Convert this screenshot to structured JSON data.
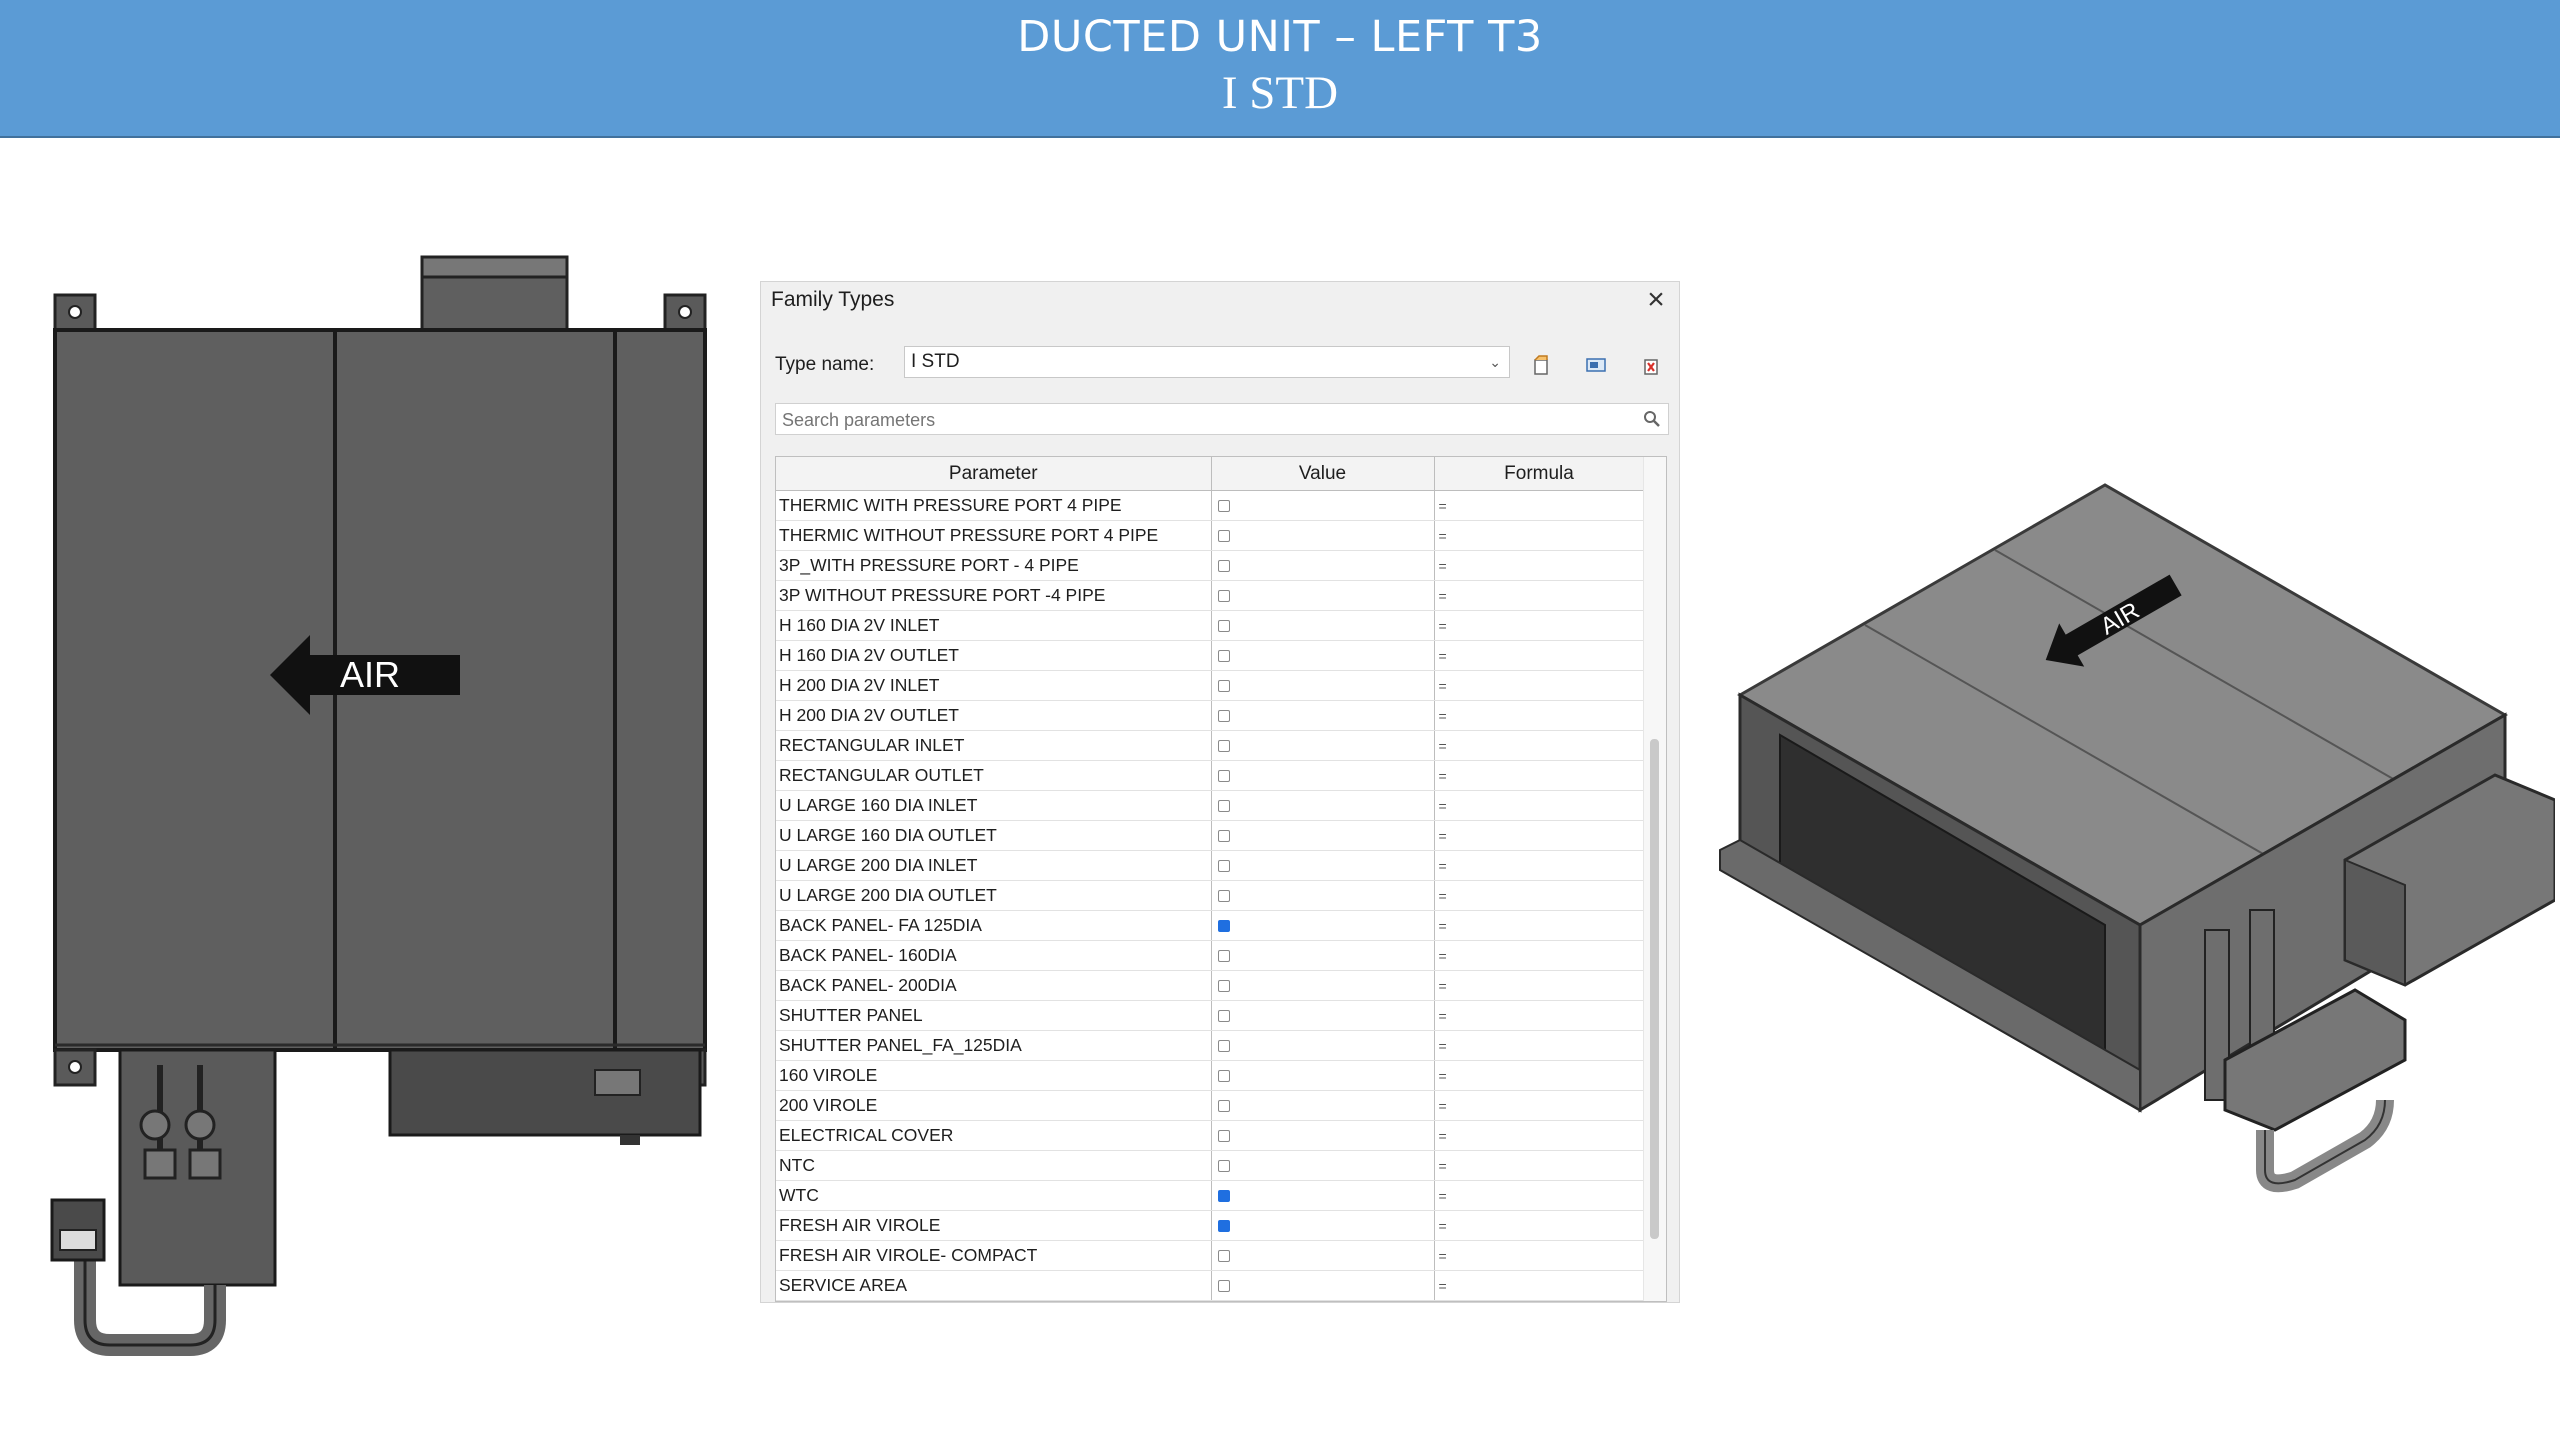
{
  "slide": {
    "title_line1": "DUCTED UNIT – LEFT T3",
    "title_line2": "I STD"
  },
  "illustrations": {
    "front_view_label": "AIR",
    "iso_view_label": "AIR"
  },
  "dialog": {
    "title": "Family Types",
    "type_name_label": "Type name:",
    "type_name_value": "I STD",
    "search_placeholder": "Search parameters",
    "columns": [
      "Parameter",
      "Value",
      "Formula"
    ],
    "rows": [
      {
        "parameter": "THERMIC WITH PRESSURE PORT 4 PIPE",
        "checked": false,
        "formula": "="
      },
      {
        "parameter": "THERMIC WITHOUT PRESSURE PORT  4 PIPE",
        "checked": false,
        "formula": "="
      },
      {
        "parameter": "3P_WITH PRESSURE PORT - 4 PIPE",
        "checked": false,
        "formula": "="
      },
      {
        "parameter": "3P WITHOUT PRESSURE PORT -4  PIPE",
        "checked": false,
        "formula": "="
      },
      {
        "parameter": "H 160 DIA 2V INLET",
        "checked": false,
        "formula": "="
      },
      {
        "parameter": "H 160 DIA 2V OUTLET",
        "checked": false,
        "formula": "="
      },
      {
        "parameter": "H 200 DIA 2V INLET",
        "checked": false,
        "formula": "="
      },
      {
        "parameter": "H 200 DIA 2V OUTLET",
        "checked": false,
        "formula": "="
      },
      {
        "parameter": "RECTANGULAR INLET",
        "checked": false,
        "formula": "="
      },
      {
        "parameter": "RECTANGULAR  OUTLET",
        "checked": false,
        "formula": "="
      },
      {
        "parameter": "U LARGE 160 DIA INLET",
        "checked": false,
        "formula": "="
      },
      {
        "parameter": "U LARGE 160 DIA OUTLET",
        "checked": false,
        "formula": "="
      },
      {
        "parameter": "U LARGE 200 DIA INLET",
        "checked": false,
        "formula": "="
      },
      {
        "parameter": "U LARGE 200 DIA OUTLET",
        "checked": false,
        "formula": "="
      },
      {
        "parameter": "BACK PANEL- FA 125DIA",
        "checked": true,
        "formula": "="
      },
      {
        "parameter": "BACK PANEL- 160DIA",
        "checked": false,
        "formula": "="
      },
      {
        "parameter": "BACK PANEL- 200DIA",
        "checked": false,
        "formula": "="
      },
      {
        "parameter": "SHUTTER PANEL",
        "checked": false,
        "formula": "="
      },
      {
        "parameter": "SHUTTER PANEL_FA_125DIA",
        "checked": false,
        "formula": "="
      },
      {
        "parameter": "160 VIROLE",
        "checked": false,
        "formula": "="
      },
      {
        "parameter": "200 VIROLE",
        "checked": false,
        "formula": "="
      },
      {
        "parameter": "ELECTRICAL COVER",
        "checked": false,
        "formula": "="
      },
      {
        "parameter": "NTC",
        "checked": false,
        "formula": "="
      },
      {
        "parameter": "WTC",
        "checked": true,
        "formula": "="
      },
      {
        "parameter": "FRESH AIR VIROLE",
        "checked": true,
        "formula": "="
      },
      {
        "parameter": "FRESH AIR VIROLE- COMPACT",
        "checked": false,
        "formula": "="
      },
      {
        "parameter": "SERVICE AREA",
        "checked": false,
        "formula": "="
      }
    ],
    "colors": {
      "checked": "#1f6fe0",
      "banner": "#5b9bd5"
    }
  }
}
